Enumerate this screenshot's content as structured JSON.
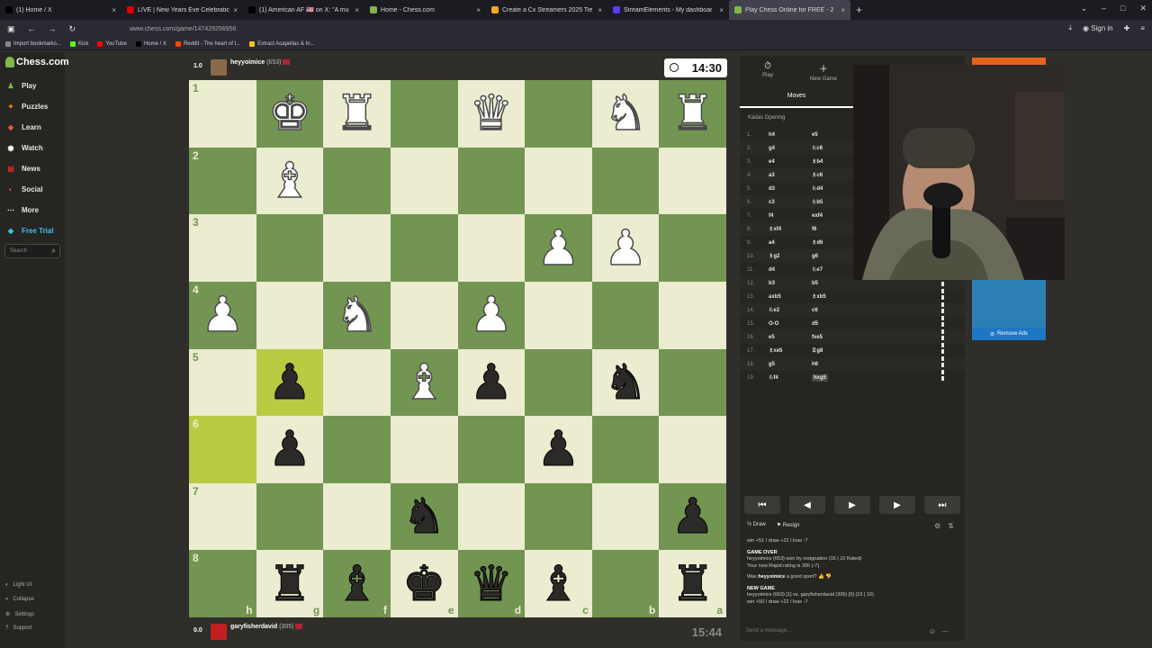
{
  "browser": {
    "tabs": [
      {
        "label": "(1) Home / X",
        "color": "#000000",
        "active": false
      },
      {
        "label": "LIVE | New Years Eve Celebratic",
        "color": "#e10000",
        "active": false
      },
      {
        "label": "(1) American AF 🇺🇸 on X: \"A mu",
        "color": "#000000",
        "active": false
      },
      {
        "label": "Home - Chess.com",
        "color": "#81b64c",
        "active": false
      },
      {
        "label": "Create a Cx Streamers 2025 Tie",
        "color": "#f5a623",
        "active": false
      },
      {
        "label": "StreamElements - My dashboar",
        "color": "#5b3cf5",
        "active": false
      },
      {
        "label": "Play Chess Online for FREE - 2",
        "color": "#81b64c",
        "active": true
      }
    ],
    "url": "www.chess.com/game/147429256956",
    "sign_in": "Sign in",
    "bookmarks": [
      {
        "label": "Import bookmarks...",
        "color": "#888888"
      },
      {
        "label": "Kick",
        "color": "#53fc18"
      },
      {
        "label": "YouTube",
        "color": "#ff0000"
      },
      {
        "label": "Home / X",
        "color": "#000000"
      },
      {
        "label": "Reddit - The heart of t...",
        "color": "#ff4500"
      },
      {
        "label": "Extract Acapellas & In...",
        "color": "#f5c518"
      }
    ]
  },
  "sidebar": {
    "logo": "Chess.com",
    "items": [
      {
        "label": "Play",
        "icon": "play-icon",
        "color": "#81b64c"
      },
      {
        "label": "Puzzles",
        "icon": "puzzle-icon",
        "color": "#f08a24"
      },
      {
        "label": "Learn",
        "icon": "learn-icon",
        "color": "#e25b3c"
      },
      {
        "label": "Watch",
        "icon": "watch-icon",
        "color": "#ffffff"
      },
      {
        "label": "News",
        "icon": "news-icon",
        "color": "#e02828"
      },
      {
        "label": "Social",
        "icon": "social-icon",
        "color": "#d9522a"
      },
      {
        "label": "More",
        "icon": "more-icon",
        "color": "#ffffff"
      },
      {
        "label": "Free Trial",
        "icon": "diamond-icon",
        "color": "#36c5f0"
      }
    ],
    "search_placeholder": "Search",
    "bottom": [
      {
        "label": "Light UI",
        "icon": "light-ui-icon"
      },
      {
        "label": "Collapse",
        "icon": "collapse-icon"
      },
      {
        "label": "Settings",
        "icon": "settings-icon"
      },
      {
        "label": "Support",
        "icon": "support-icon"
      }
    ]
  },
  "players": {
    "top": {
      "score": "1.0",
      "name": "heyyoimice",
      "rating": "(653)",
      "clock": "14:30"
    },
    "bottom": {
      "score": "0.0",
      "name": "garyfisherdavid",
      "rating": "(305)",
      "clock": "15:44"
    }
  },
  "board": {
    "ranks": [
      "1",
      "2",
      "3",
      "4",
      "5",
      "6",
      "7",
      "8"
    ],
    "files": [
      "h",
      "g",
      "f",
      "e",
      "d",
      "c",
      "b",
      "a"
    ],
    "highlighted": [
      "g5",
      "h6"
    ],
    "pieces": {
      "g1": "white-king",
      "f1": "white-rook",
      "d1": "white-queen",
      "b1": "white-knight",
      "a1": "white-rook",
      "g2": "white-bishop",
      "c3": "white-pawn",
      "b3": "white-pawn",
      "h4": "white-pawn",
      "f4": "white-knight",
      "d4": "white-pawn",
      "g5": "black-pawn",
      "e5": "white-bishop",
      "d5": "black-pawn",
      "b5": "black-knight",
      "g6": "black-pawn",
      "c6": "black-pawn",
      "e7": "black-knight",
      "a7": "black-pawn",
      "g8": "black-rook",
      "f8": "black-bishop",
      "e8": "black-king",
      "d8": "black-queen",
      "c8": "black-bishop",
      "a8": "black-rook"
    }
  },
  "right_panel": {
    "tabs": [
      {
        "label": "Play",
        "icon": "stopwatch-icon"
      },
      {
        "label": "New Game",
        "icon": "plus-icon"
      }
    ],
    "moves_tab": "Moves",
    "opening": "Kádas Opening",
    "moves": [
      [
        "1.",
        "h4",
        "e5"
      ],
      [
        "2.",
        "g4",
        "♘c6"
      ],
      [
        "3.",
        "e4",
        "♗b4"
      ],
      [
        "4.",
        "a3",
        "♗c6"
      ],
      [
        "5.",
        "d3",
        "♘d4"
      ],
      [
        "6.",
        "c3",
        "♘b5"
      ],
      [
        "7.",
        "f4",
        "exf4"
      ],
      [
        "8.",
        "♗xf4",
        "f6"
      ],
      [
        "9.",
        "a4",
        "♗d6"
      ],
      [
        "10.",
        "♗g2",
        "g6"
      ],
      [
        "11.",
        "d4",
        "♘e7"
      ],
      [
        "12.",
        "b3",
        "b5"
      ],
      [
        "13.",
        "axb5",
        "♗xb5"
      ],
      [
        "14.",
        "♘e2",
        "c6"
      ],
      [
        "15.",
        "O-O",
        "d5"
      ],
      [
        "16.",
        "e5",
        "fxe5"
      ],
      [
        "17.",
        "♗xe5",
        "♖g8"
      ],
      [
        "18.",
        "g5",
        "h6"
      ],
      [
        "19.",
        "♘f4",
        "hxg5"
      ]
    ],
    "draw": "Draw",
    "resign": "Resign",
    "chat": {
      "line1": "win +51 / draw +22 / lose -7",
      "game_over": "GAME OVER",
      "result": "heyyoimice (653) won by resignation (15 | 10 Rated)",
      "rating": "Your new Rapid rating is 305 (-7).",
      "sport_prefix": "Was ",
      "sport_name": "heyyoimice",
      "sport_suffix": " a good sport?",
      "new_game": "NEW GAME",
      "new_line": "heyyoimice (653) [1] vs. garyfisherdavid (305) [0] (15 | 10)",
      "new_line2": "win +50 / draw +22 / lose -7",
      "placeholder": "Send a message..."
    }
  },
  "ad": {
    "remove_ads": "Remove Ads"
  },
  "colors": {
    "light": "#ebecd0",
    "dark": "#739552",
    "highlight_light": "#f5f682",
    "highlight_dark": "#b9ca43"
  }
}
